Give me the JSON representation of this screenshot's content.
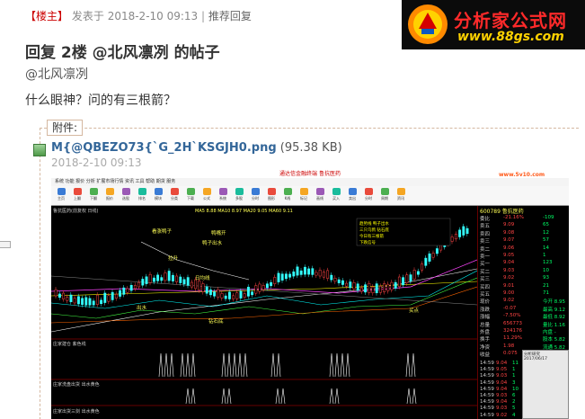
{
  "post": {
    "author_tag": "【楼主】",
    "posted_label": "发表于",
    "timestamp": "2018-2-10 09:13",
    "recommend_label": "推荐回复",
    "title": "回复 2楼 @北风凛冽 的帖子",
    "mention": "@北风凛冽",
    "body": "什么眼神？问的有三根箭？"
  },
  "logo": {
    "name": "分析家公式网",
    "url": "www.88gs.com"
  },
  "attachment": {
    "label": "附件:",
    "filename": "M{@QBEZO73{`G_2H`KSGJH0.png",
    "size": "(95.38 KB)",
    "date": "2018-2-10 09:13",
    "icon": "image-file-icon"
  },
  "screenshot": {
    "window_title": "通达信金融终端 鲁抗医药",
    "watermark": "www.5v10.com",
    "menu": "系统  功能  报价  分析  扩展市场行情  资讯  工具  帮助   期货   服务",
    "stock_title": "600789 鲁抗医药",
    "toolbar": [
      "主页",
      "上翻",
      "下翻",
      "报价",
      "选股",
      "排名",
      "模块",
      "分类",
      "下载",
      "公式",
      "系统",
      "多股",
      "分时",
      "图形",
      "K线",
      "标记",
      "画线",
      "买入",
      "卖出",
      "分时",
      "周期",
      "资讯"
    ],
    "chart_info": "鲁抗医药(前复权 日线)",
    "ma_line": "MA5 8.88  MA10 8.97  MA20 9.05  MA60 9.11",
    "chart_labels": [
      "看涨鸭子",
      "鸭嘴开",
      "鸭子出水",
      "拉升",
      "日均线",
      "钻石底",
      "出水",
      "买点"
    ],
    "indicators": [
      "庄家建仓  紫色线",
      "庄家洗盘出货  出水黄色",
      "庄家出货三剑  出水黄色"
    ],
    "panel_rows": [
      {
        "l": "委比",
        "v": "-21.16%",
        "r": "-109"
      },
      {
        "l": "卖五",
        "v": "9.09",
        "r": "65"
      },
      {
        "l": "卖四",
        "v": "9.08",
        "r": "12"
      },
      {
        "l": "卖三",
        "v": "9.07",
        "r": "57"
      },
      {
        "l": "卖二",
        "v": "9.06",
        "r": "14"
      },
      {
        "l": "卖一",
        "v": "9.05",
        "r": "1"
      },
      {
        "l": "买一",
        "v": "9.04",
        "r": "123"
      },
      {
        "l": "买二",
        "v": "9.03",
        "r": "10"
      },
      {
        "l": "买三",
        "v": "9.02",
        "r": "93"
      },
      {
        "l": "买四",
        "v": "9.01",
        "r": "21"
      },
      {
        "l": "买五",
        "v": "9.00",
        "r": "71"
      },
      {
        "l": "现价",
        "v": "9.02",
        "r": "今开 8.95"
      },
      {
        "l": "涨跌",
        "v": "-0.07",
        "r": "最高 9.12"
      },
      {
        "l": "涨幅",
        "v": "-7.50%",
        "r": "最低 8.92"
      },
      {
        "l": "总量",
        "v": "656773",
        "r": "量比 1.16"
      },
      {
        "l": "外盘",
        "v": "324176",
        "r": "内盘 -"
      },
      {
        "l": "换手",
        "v": "11.29%",
        "r": "股本 5.82"
      },
      {
        "l": "净资",
        "v": "1.98",
        "r": "流通 5.82"
      },
      {
        "l": "收益",
        "v": "0.075",
        "r": "PE 20.86"
      }
    ],
    "ticks": [
      {
        "t": "14:59",
        "p": "9.04",
        "c": "11"
      },
      {
        "t": "14:59",
        "p": "9.05",
        "c": "1"
      },
      {
        "t": "14:59",
        "p": "9.03",
        "c": "1"
      },
      {
        "t": "14:59",
        "p": "9.04",
        "c": "3"
      },
      {
        "t": "14:59",
        "p": "9.04",
        "c": "10"
      },
      {
        "t": "14:59",
        "p": "9.03",
        "c": "6"
      },
      {
        "t": "14:59",
        "p": "9.04",
        "c": "2"
      },
      {
        "t": "14:59",
        "p": "9.03",
        "c": "5"
      },
      {
        "t": "14:59",
        "p": "9.02",
        "c": "4"
      }
    ],
    "popup_title": "分析研究",
    "popup_date": "2017/06/17"
  },
  "colors": {
    "red_tag": "#cc0000",
    "logo_red": "#ff2a2a",
    "logo_yellow": "#ffd200",
    "link_blue": "#336699"
  }
}
